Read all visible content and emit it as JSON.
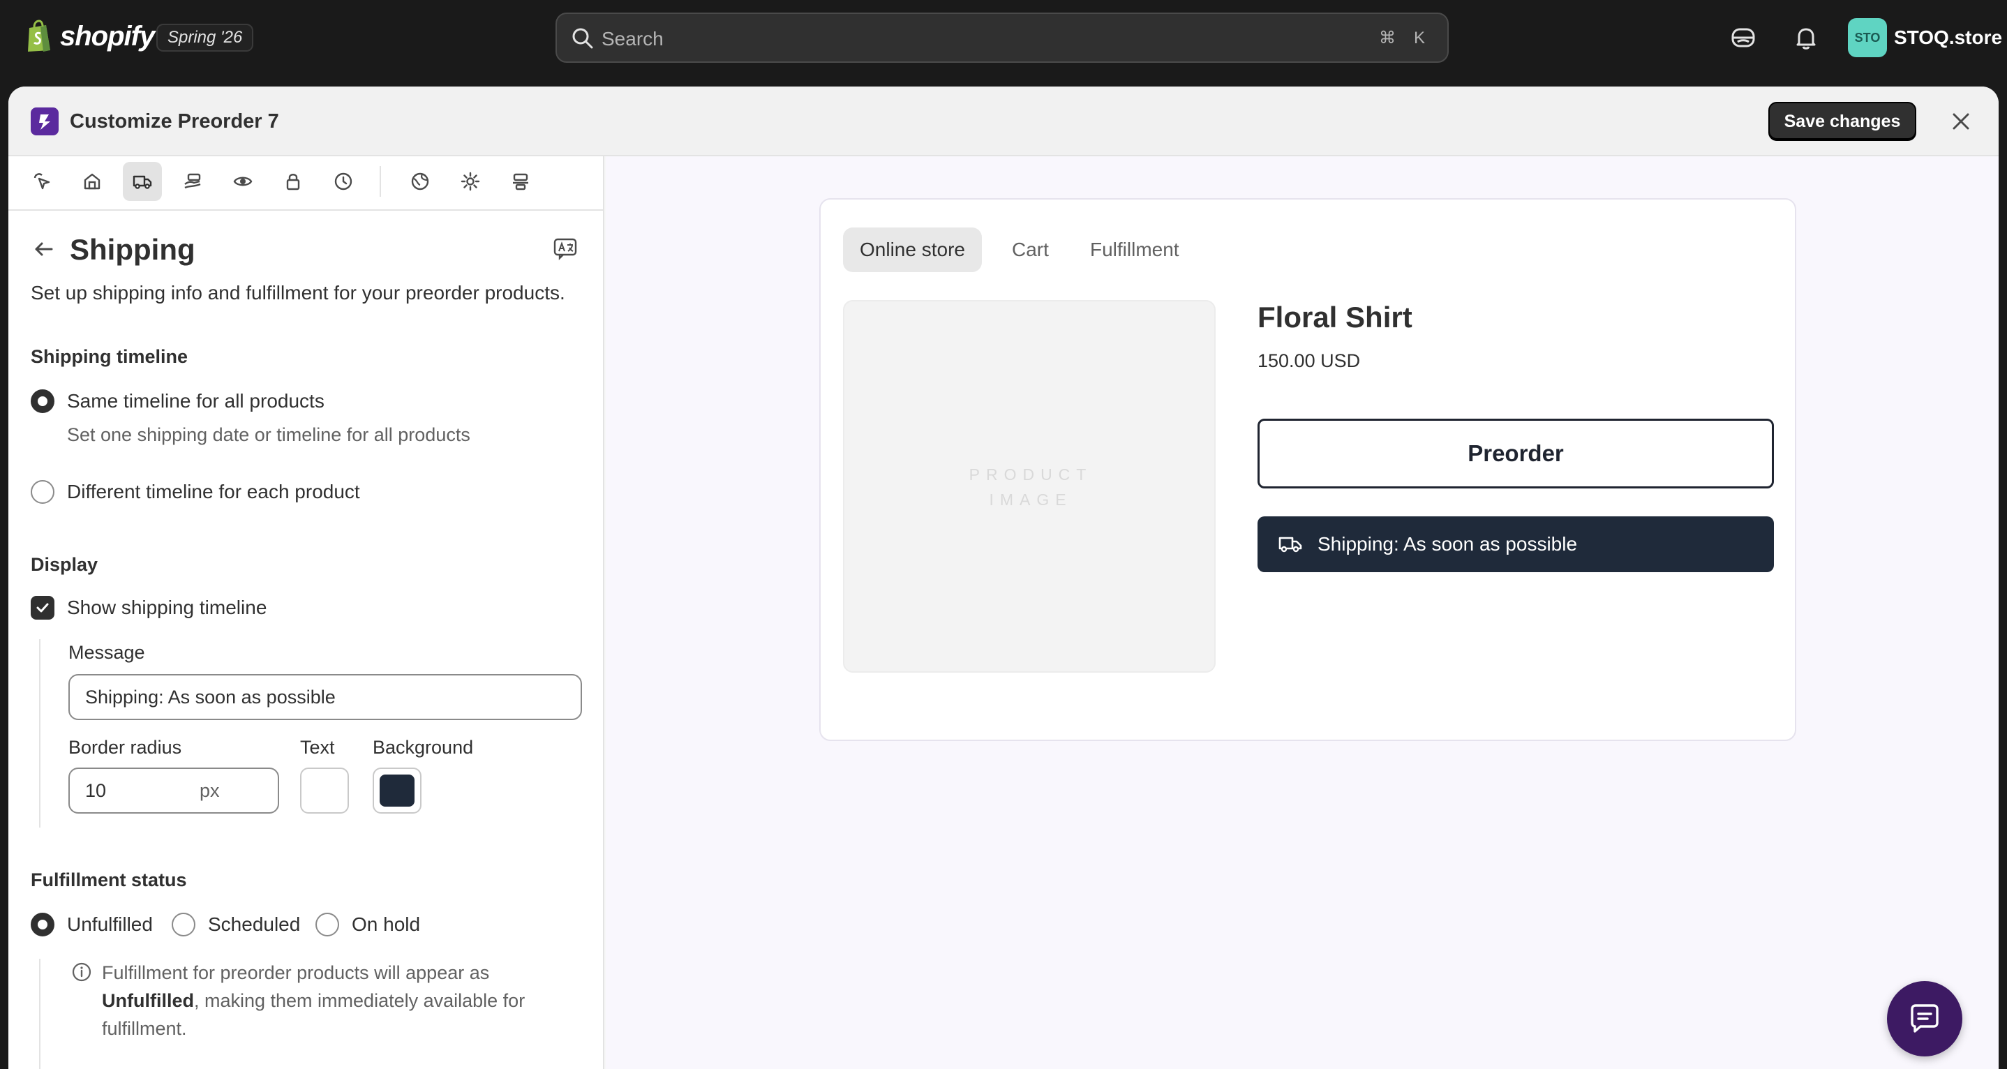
{
  "topbar": {
    "logo_text": "shopify",
    "edition": "Spring '26",
    "search_placeholder": "Search",
    "shortcut_cmd": "⌘",
    "shortcut_key": "K",
    "avatar_initials": "STO",
    "store_name": "STOQ.store"
  },
  "modal": {
    "title": "Customize Preorder 7",
    "save_label": "Save changes"
  },
  "sidebar": {
    "icons": [
      "cursor-click-icon",
      "storefront-icon",
      "truck-icon",
      "hand-money-icon",
      "eye-icon",
      "lock-icon",
      "clock-icon",
      "globe-icon",
      "gear-icon",
      "layout-icon"
    ],
    "active_icon": "truck-icon"
  },
  "shipping": {
    "title": "Shipping",
    "description": "Set up shipping info and fulfillment for your preorder products.",
    "timeline_label": "Shipping timeline",
    "timeline_options": [
      {
        "label": "Same timeline for all products",
        "help": "Set one shipping date or timeline for all products",
        "selected": true
      },
      {
        "label": "Different timeline for each product",
        "selected": false
      }
    ],
    "display_label": "Display",
    "show_timeline_label": "Show shipping timeline",
    "show_timeline_checked": true,
    "message_label": "Message",
    "message_value": "Shipping: As soon as possible",
    "border_radius_label": "Border radius",
    "border_radius_value": "10",
    "border_radius_unit": "px",
    "text_color_label": "Text",
    "text_color": "#ffffff",
    "background_label": "Background",
    "background_color": "#1f2a3a",
    "fulfillment_label": "Fulfillment status",
    "fulfillment_options": [
      {
        "label": "Unfulfilled",
        "selected": true
      },
      {
        "label": "Scheduled",
        "selected": false
      },
      {
        "label": "On hold",
        "selected": false
      }
    ],
    "info_line1": "Fulfillment for preorder products will appear as",
    "info_bold": "Unfulfilled",
    "info_line2_rest": ", making them immediately available for",
    "info_line3": "fulfillment."
  },
  "preview": {
    "tabs": [
      "Online store",
      "Cart",
      "Fulfillment"
    ],
    "active_tab": "Online store",
    "image_placeholder_line1": "PRODUCT",
    "image_placeholder_line2": "IMAGE",
    "product_name": "Floral Shirt",
    "product_price": "150.00 USD",
    "preorder_button": "Preorder",
    "shipping_message": "Shipping: As soon as possible"
  },
  "colors": {
    "accent_dark": "#303030",
    "app_brand": "#5b2a9e",
    "ship_bar": "#1f2a3a",
    "chat_bubble": "#3d1a63"
  }
}
